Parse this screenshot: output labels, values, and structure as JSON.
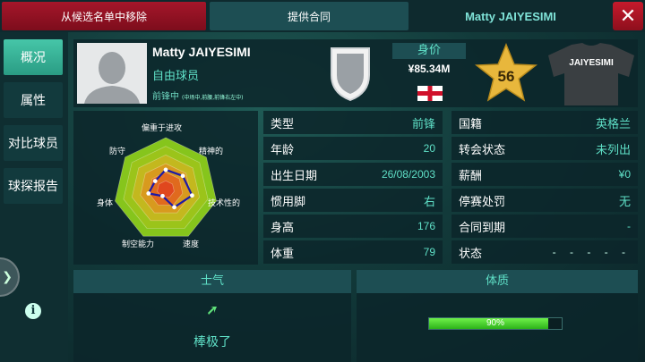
{
  "topbar": {
    "remove_label": "从候选名单中移除",
    "offer_label": "提供合同",
    "player_title": "Matty JAIYESIMI",
    "close_label": "✕"
  },
  "sidebar": {
    "items": [
      {
        "label": "概况",
        "active": true
      },
      {
        "label": "属性",
        "active": false
      },
      {
        "label": "对比球员",
        "active": false
      },
      {
        "label": "球探报告",
        "active": false
      }
    ],
    "info_label": "i"
  },
  "player": {
    "name": "Matty JAIYESIMI",
    "status": "自由球员",
    "position": "前锋中",
    "position_detail": "(中场中,前腰,前锋右左中)",
    "value_label": "身价",
    "value": "¥85.34M",
    "rating": "56",
    "jersey_name": "JAIYESIMI"
  },
  "radar": {
    "labels": [
      "偏重于进攻",
      "精神的",
      "技术性的",
      "速度",
      "制空能力",
      "身体",
      "防守"
    ],
    "values": [
      0.38,
      0.42,
      0.52,
      0.38,
      0.14,
      0.34,
      0.26
    ],
    "colors": {
      "inner": "#e0471e",
      "outer": "#86c51c",
      "line": "#1b1aa8"
    }
  },
  "stats_left": [
    {
      "key": "类型",
      "value": "前锋"
    },
    {
      "key": "年龄",
      "value": "20"
    },
    {
      "key": "出生日期",
      "value": "26/08/2003"
    },
    {
      "key": "惯用脚",
      "value": "右"
    },
    {
      "key": "身高",
      "value": "176"
    },
    {
      "key": "体重",
      "value": "79"
    }
  ],
  "stats_right": [
    {
      "key": "国籍",
      "value": "英格兰"
    },
    {
      "key": "转会状态",
      "value": "未列出"
    },
    {
      "key": "薪酬",
      "value": "¥0"
    },
    {
      "key": "停赛处罚",
      "value": "无"
    },
    {
      "key": "合同到期",
      "value": "-"
    },
    {
      "key": "状态",
      "value": "- - - - -"
    }
  ],
  "morale": {
    "title": "士气",
    "value": "棒极了"
  },
  "fitness": {
    "title": "体质",
    "value_text": "90%",
    "level": 0.9
  }
}
